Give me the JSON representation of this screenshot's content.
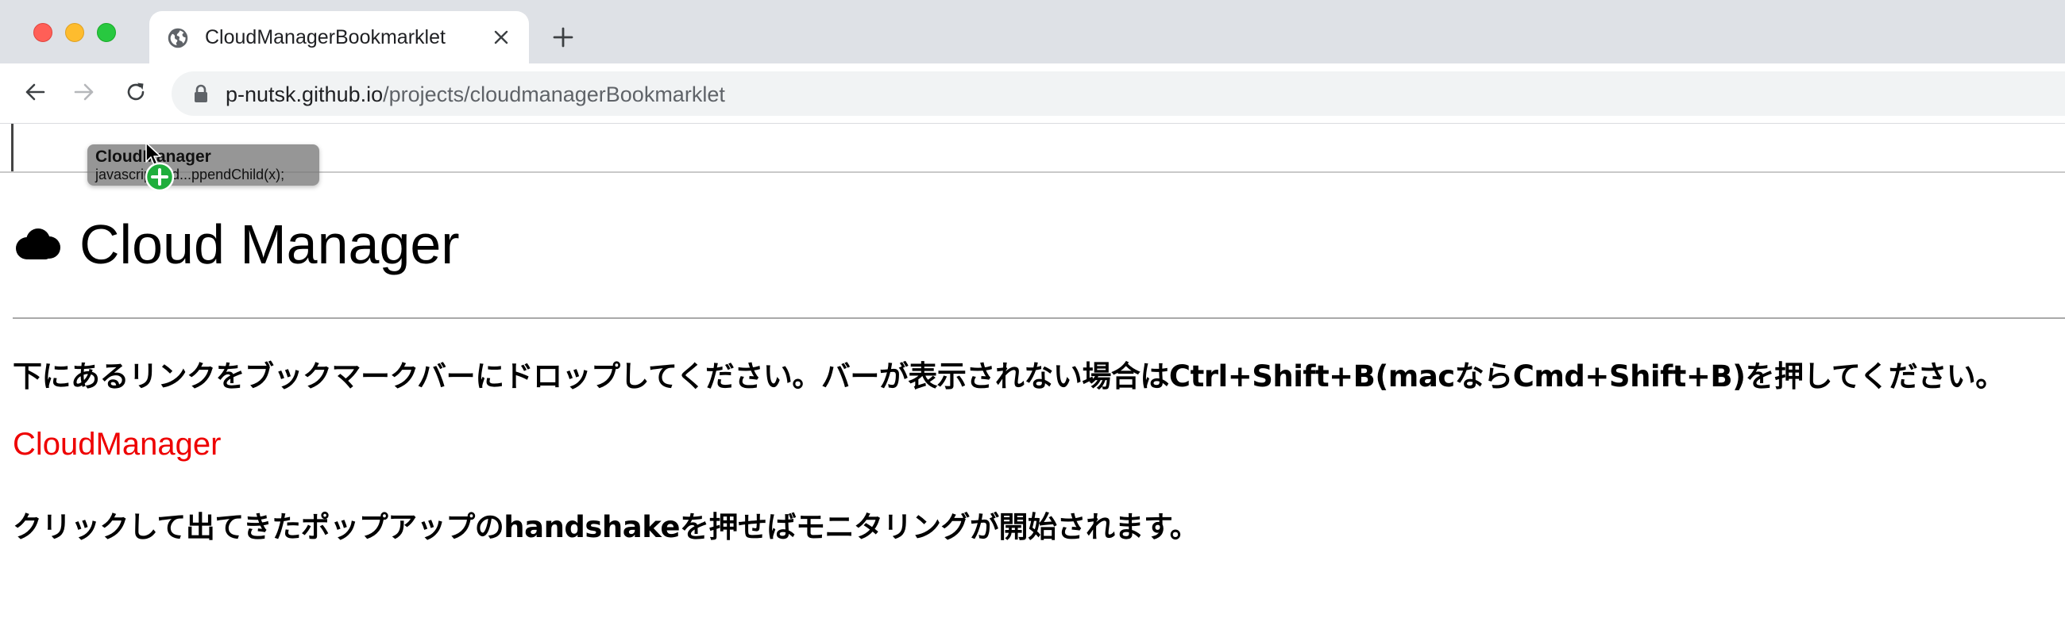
{
  "browser": {
    "tab": {
      "title": "CloudManagerBookmarklet",
      "icon": "globe-icon"
    },
    "address_bar": {
      "host": "p-nutsk.github.io",
      "path": "/projects/cloudmanagerBookmarklet"
    }
  },
  "drag_ghost": {
    "title": "CloudManager",
    "url": "javascript:...d...ppendChild(x);"
  },
  "page": {
    "title": "Cloud Manager",
    "instruction": "下にあるリンクをブックマークバーにドロップしてください。バーが表示されない場合はCtrl+Shift+B(macならCmd+Shift+B)を押してください。",
    "link_label": "CloudManager",
    "hint": "クリックして出てきたポップアップのhandshakeを押せばモニタリングが開始されます。"
  },
  "colors": {
    "link": "#ee0000",
    "tab_strip": "#dee1e6",
    "omnibox": "#f1f3f4"
  }
}
